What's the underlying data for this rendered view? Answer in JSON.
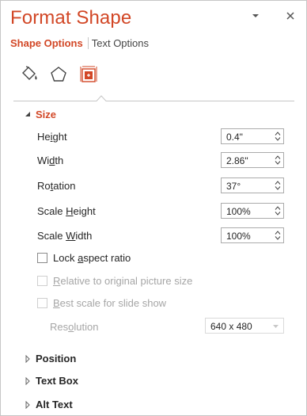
{
  "pane": {
    "title": "Format Shape",
    "menu_icon": "chevron-down-icon",
    "close_icon": "close-icon"
  },
  "tabs": [
    {
      "label": "Shape Options",
      "active": true
    },
    {
      "label": "Text Options",
      "active": false
    }
  ],
  "category_icons": [
    {
      "name": "fill-line-icon",
      "active": false
    },
    {
      "name": "effects-pentagon-icon",
      "active": false
    },
    {
      "name": "size-properties-icon",
      "active": true
    }
  ],
  "size": {
    "header": "Size",
    "expanded": true,
    "height": {
      "label_pre": "He",
      "label_u": "i",
      "label_post": "ght",
      "value": "0.4\""
    },
    "width": {
      "label_pre": "Wi",
      "label_u": "d",
      "label_post": "th",
      "value": "2.86\""
    },
    "rotation": {
      "label_pre": "Ro",
      "label_u": "t",
      "label_post": "ation",
      "value": "37°"
    },
    "scale_height": {
      "label_pre": "Scale ",
      "label_u": "H",
      "label_post": "eight",
      "value": "100%"
    },
    "scale_width": {
      "label_pre": "Scale ",
      "label_u": "W",
      "label_post": "idth",
      "value": "100%"
    },
    "lock_aspect": {
      "label_pre": "Lock ",
      "label_u": "a",
      "label_post": "spect ratio",
      "checked": false,
      "enabled": true
    },
    "relative_original": {
      "label_pre": "",
      "label_u": "R",
      "label_post": "elative to original picture size",
      "checked": false,
      "enabled": false
    },
    "best_scale": {
      "label_pre": "",
      "label_u": "B",
      "label_post": "est scale for slide show",
      "checked": false,
      "enabled": false
    },
    "resolution": {
      "label_pre": "Res",
      "label_u": "o",
      "label_post": "lution",
      "value": "640 x 480",
      "enabled": false
    }
  },
  "sections": [
    {
      "label": "Position",
      "expanded": false
    },
    {
      "label": "Text Box",
      "expanded": false
    },
    {
      "label": "Alt Text",
      "expanded": false
    }
  ],
  "colors": {
    "accent": "#d24726",
    "text": "#262626",
    "disabled": "#a6a6a6",
    "border": "#ababab"
  }
}
